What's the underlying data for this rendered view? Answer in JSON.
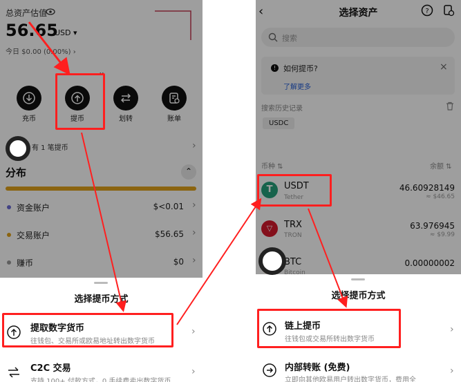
{
  "left": {
    "header_label": "总资产估值",
    "balance": "56.65",
    "currency": "USD ▾",
    "today": "今日 $0.00 (0.00%) ›",
    "actions": [
      {
        "label": "充币",
        "icon": "deposit-icon"
      },
      {
        "label": "提币",
        "icon": "withdraw-icon"
      },
      {
        "label": "划转",
        "icon": "transfer-icon"
      },
      {
        "label": "账单",
        "icon": "bill-icon"
      }
    ],
    "pending_text": "有 1 笔提币",
    "section_title": "分布",
    "accounts": [
      {
        "label": "资金账户",
        "value": "$<0.01",
        "color": "#6b6bd6"
      },
      {
        "label": "交易账户",
        "value": "$56.65",
        "color": "#e0a21a"
      },
      {
        "label": "赚币",
        "value": "$0",
        "color": "#9a9a9a"
      }
    ],
    "sheet": {
      "title": "选择提币方式",
      "options": [
        {
          "title": "提取数字货币",
          "subtitle": "往钱包、交易所或欧易地址转出数字货币"
        },
        {
          "title": "C2C 交易",
          "subtitle": "支持 100+ 付款方式，0 手续费卖出数字货币"
        }
      ]
    }
  },
  "right": {
    "title": "选择资产",
    "search_placeholder": "搜索",
    "notice_title": "如何提币?",
    "notice_link": "了解更多",
    "history_label": "搜索历史记录",
    "history_chip": "USDC",
    "col_coin": "币种 ⇅",
    "col_balance": "余额 ⇅",
    "coins": [
      {
        "symbol": "USDT",
        "name": "Tether",
        "amount": "46.60928149",
        "usd": "≈ $46.65",
        "color": "#26a17b"
      },
      {
        "symbol": "TRX",
        "name": "TRON",
        "amount": "63.976945",
        "usd": "≈ $9.99",
        "color": "#d6192c"
      },
      {
        "symbol": "BTC",
        "name": "Bitcoin",
        "amount": "0.00000002",
        "usd": "",
        "color": "#f7931a"
      }
    ],
    "sheet": {
      "title": "选择提币方式",
      "options": [
        {
          "title": "链上提币",
          "subtitle": "往钱包或交易所转出数字货币"
        },
        {
          "title": "内部转账 (免费)",
          "subtitle": "立即向其他欧易用户转出数字货币，费用全"
        }
      ]
    }
  },
  "colors": {
    "highlight": "#ff1f1f",
    "dark_button": "#111111",
    "gold_bar": "#e0a21a"
  }
}
